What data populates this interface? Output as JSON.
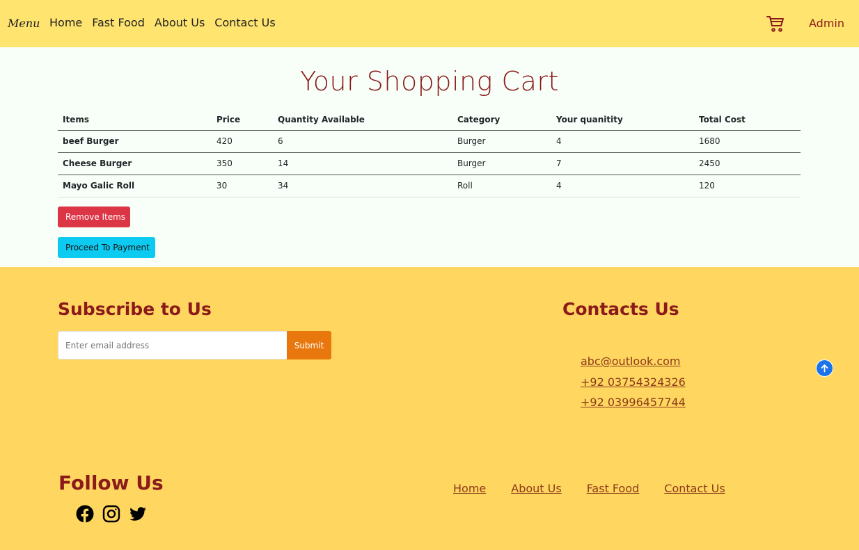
{
  "nav": {
    "brand": "Menu",
    "links": [
      "Home",
      "Fast Food",
      "About Us",
      "Contact Us"
    ],
    "cart_icon": "shopping-cart-icon",
    "admin_label": "Admin"
  },
  "cart": {
    "title": "Your Shopping Cart",
    "columns": [
      "Items",
      "Price",
      "Quantity Available",
      "Category",
      "Your quanitity",
      "Total Cost"
    ],
    "rows": [
      [
        "beef Burger",
        "420",
        "6",
        "Burger",
        "4",
        "1680"
      ],
      [
        "Cheese Burger",
        "350",
        "14",
        "Burger",
        "7",
        "2450"
      ],
      [
        "Mayo Galic Roll",
        "30",
        "34",
        "Roll",
        "4",
        "120"
      ]
    ],
    "remove_label": "Remove Items",
    "proceed_label": "Proceed To Payment"
  },
  "footer": {
    "subscribe_title": "Subscribe to Us",
    "email_placeholder": "Enter email address",
    "submit_label": "Submit",
    "contacts_title": "Contacts Us",
    "contacts": [
      "abc@outlook.com",
      "+92 03754324326",
      "+92 03996457744"
    ],
    "follow_title": "Follow Us",
    "social_icons": [
      "facebook-icon",
      "instagram-icon",
      "twitter-icon"
    ],
    "links": [
      "Home",
      "About Us",
      "Fast Food",
      "Contact Us"
    ]
  },
  "colors": {
    "nav_bg": "#ffe46f",
    "footer_bg": "#ffd65f",
    "title_color": "#8b1a1a",
    "remove_btn": "#dc3545",
    "proceed_btn": "#0dcaf0",
    "submit_btn": "#e8780e",
    "scroll_top": "#1a73e8"
  }
}
